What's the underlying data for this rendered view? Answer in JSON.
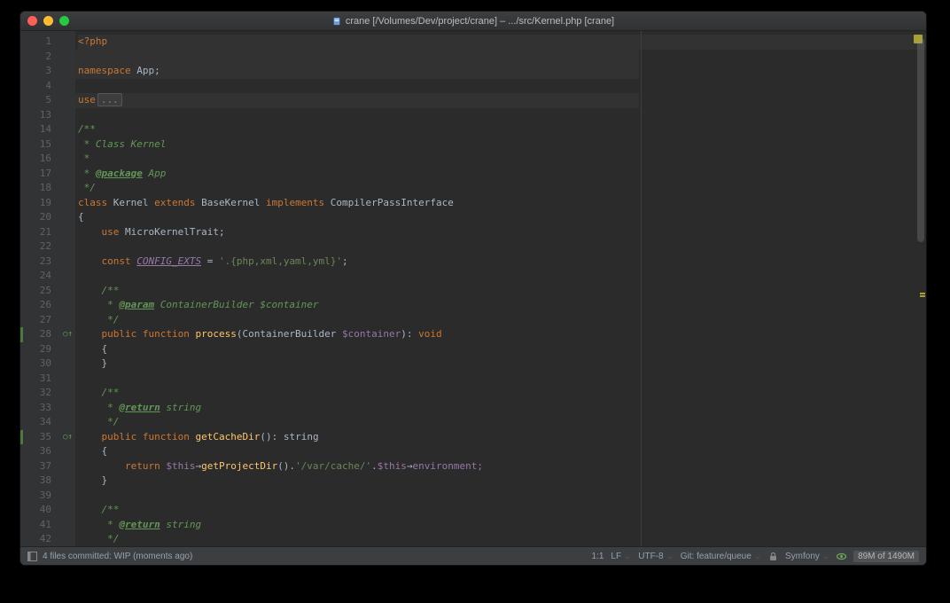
{
  "window": {
    "title": "crane [/Volumes/Dev/project/crane] – .../src/Kernel.php [crane]"
  },
  "gutter": {
    "lines": [
      "1",
      "2",
      "3",
      "4",
      "5",
      "13",
      "14",
      "15",
      "16",
      "17",
      "18",
      "19",
      "20",
      "21",
      "22",
      "23",
      "24",
      "25",
      "26",
      "27",
      "28",
      "29",
      "30",
      "31",
      "32",
      "33",
      "34",
      "35",
      "36",
      "37",
      "38",
      "39",
      "40",
      "41",
      "42"
    ],
    "modified": [
      "28",
      "35"
    ]
  },
  "code": {
    "l1_tag": "<?php",
    "l3_ns": "namespace",
    "l3_ns_name": " App;",
    "l5_use": "use",
    "l5_fold": "...",
    "l14_doc": "/**",
    "l15_doc": " * Class Kernel",
    "l16_doc": " *",
    "l17_doc_pre": " * ",
    "l17_tag": "@package",
    "l17_doc_post": " App",
    "l18_doc": " */",
    "l19_class": "class",
    "l19_name": " Kernel ",
    "l19_ext": "extends",
    "l19_base": " BaseKernel ",
    "l19_impl": "implements",
    "l19_iface": " CompilerPassInterface",
    "l20_brace": "{",
    "l21_use": "    use",
    "l21_trait": " MicroKernelTrait;",
    "l23_const": "    const ",
    "l23_name": "CONFIG_EXTS",
    "l23_eq": " = ",
    "l23_val": "'.{php,xml,yaml,yml}'",
    "l23_semi": ";",
    "l25_doc": "    /**",
    "l26_doc_pre": "     * ",
    "l26_tag": "@param",
    "l26_doc_post": " ContainerBuilder $container",
    "l27_doc": "     */",
    "l28_vis": "    public ",
    "l28_fn": "function",
    "l28_sp": " ",
    "l28_name": "process",
    "l28_sig_a": "(ContainerBuilder ",
    "l28_var": "$container",
    "l28_sig_b": "): ",
    "l28_void": "void",
    "l29_br": "    {",
    "l30_br": "    }",
    "l32_doc": "    /**",
    "l33_doc_pre": "     * ",
    "l33_tag": "@return",
    "l33_doc_post": " string",
    "l34_doc": "     */",
    "l35_vis": "    public ",
    "l35_fn": "function",
    "l35_sp": " ",
    "l35_name": "getCacheDir",
    "l35_sig": "(): ",
    "l35_ret": "string",
    "l36_br": "    {",
    "l37_ret_kw": "        return ",
    "l37_this": "$this",
    "l37_arr1": "→",
    "l37_call": "getProjectDir",
    "l37_paren": "().",
    "l37_str": "'/var/cache/'",
    "l37_cat": ".",
    "l37_this2": "$this",
    "l37_arr2": "→",
    "l37_env": "environment;",
    "l38_br": "    }",
    "l40_doc": "    /**",
    "l41_doc_pre": "     * ",
    "l41_tag": "@return",
    "l41_doc_post": " string",
    "l42_doc": "     */"
  },
  "status": {
    "commit": "4 files committed: WIP (moments ago)",
    "pos": "1:1",
    "le": "LF",
    "enc": "UTF-8",
    "git": "Git: feature/queue",
    "fw": "Symfony",
    "mem": "89M of 1490M"
  }
}
